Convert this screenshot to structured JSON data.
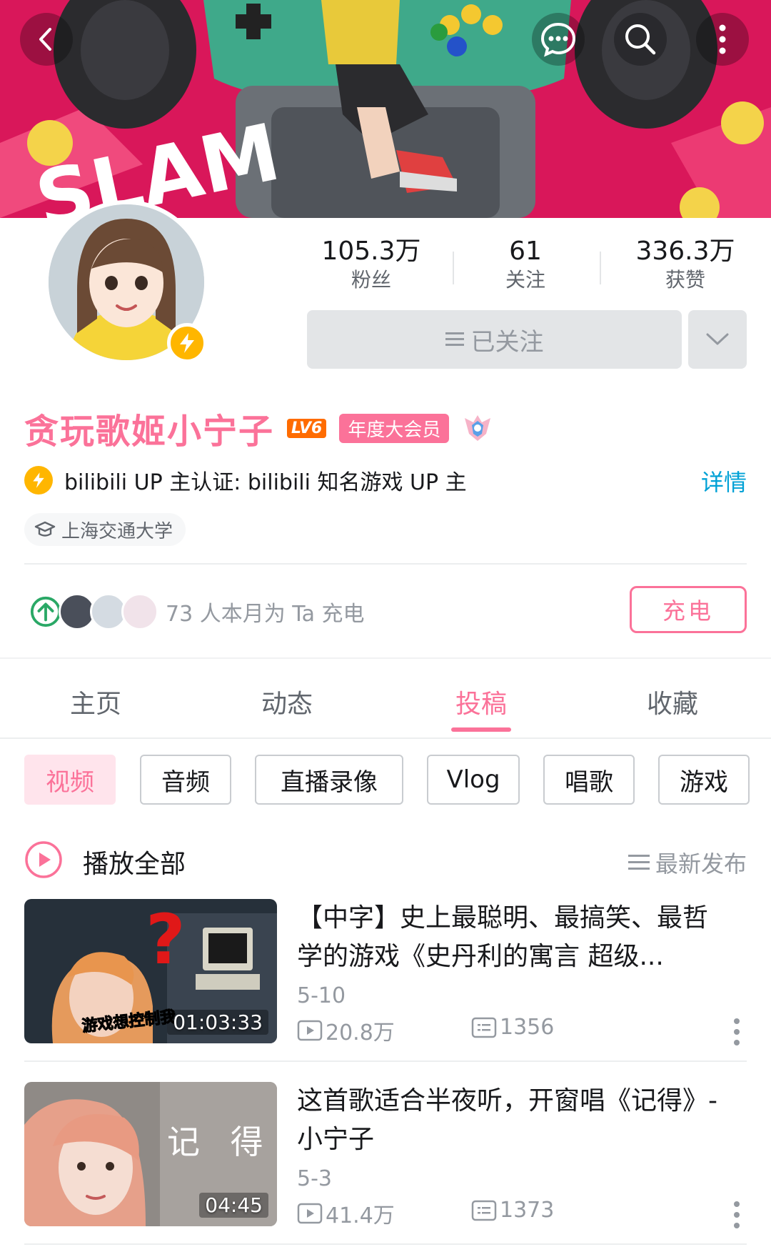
{
  "header": {
    "back_icon": "back-arrow-icon",
    "message_icon": "chat-bubble-icon",
    "search_icon": "search-icon",
    "more_icon": "more-vertical-icon"
  },
  "profile": {
    "stats": [
      {
        "value": "105.3万",
        "label": "粉丝"
      },
      {
        "value": "61",
        "label": "关注"
      },
      {
        "value": "336.3万",
        "label": "获赞"
      }
    ],
    "follow_label": "已关注",
    "name": "贪玩歌姬小宁子",
    "level": "LV6",
    "vip_label": "年度大会员",
    "verify_text": "bilibili UP 主认证: bilibili 知名游戏 UP 主",
    "detail_link": "详情",
    "school": "上海交通大学",
    "charge_text": "73 人本月为 Ta 充电",
    "charge_button": "充电"
  },
  "tabs": [
    {
      "label": "主页",
      "active": false
    },
    {
      "label": "动态",
      "active": false
    },
    {
      "label": "投稿",
      "active": true
    },
    {
      "label": "收藏",
      "active": false
    }
  ],
  "chips": [
    "视频",
    "音频",
    "直播录像",
    "Vlog",
    "唱歌",
    "游戏"
  ],
  "play_all": {
    "label": "播放全部",
    "sort_label": "最新发布"
  },
  "videos": [
    {
      "title": "【中字】史上最聪明、最搞笑、最哲学的游戏《史丹利的寓言 超级...",
      "duration": "01:03:33",
      "date": "5-10",
      "views": "20.8万",
      "comments": "1356",
      "thumb_caption": "游戏想控制我"
    },
    {
      "title": "这首歌适合半夜听，开窗唱《记得》- 小宁子",
      "duration": "04:45",
      "date": "5-3",
      "views": "41.4万",
      "comments": "1373",
      "thumb_caption": "记 得"
    }
  ],
  "colors": {
    "accent": "#fb7299",
    "link": "#00a1d6",
    "muted": "#9499a0",
    "badge_gold": "#ffb600"
  }
}
